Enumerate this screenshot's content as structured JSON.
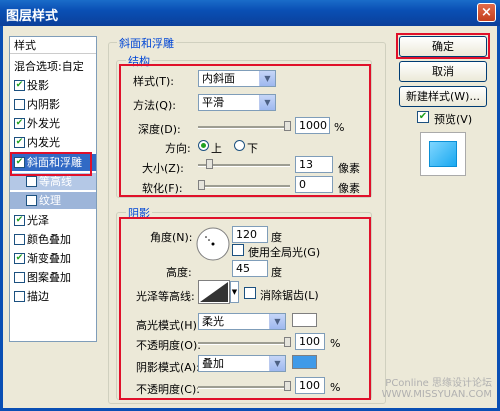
{
  "window": {
    "title": "图层样式"
  },
  "sidebar": {
    "header": "样式",
    "items": [
      {
        "label": "混合选项:自定",
        "checked": null
      },
      {
        "label": "投影",
        "checked": true
      },
      {
        "label": "内阴影",
        "checked": false
      },
      {
        "label": "外发光",
        "checked": true
      },
      {
        "label": "内发光",
        "checked": true
      },
      {
        "label": "斜面和浮雕",
        "checked": true,
        "selected": true
      },
      {
        "label": "等高线",
        "checked": false,
        "sub": true
      },
      {
        "label": "纹理",
        "checked": false,
        "sub": true
      },
      {
        "label": "光泽",
        "checked": true
      },
      {
        "label": "颜色叠加",
        "checked": false
      },
      {
        "label": "渐变叠加",
        "checked": true
      },
      {
        "label": "图案叠加",
        "checked": false
      },
      {
        "label": "描边",
        "checked": false
      }
    ]
  },
  "bevel": {
    "section_title": "斜面和浮雕",
    "structure_title": "结构",
    "style_label": "样式(T):",
    "style_value": "内斜面",
    "method_label": "方法(Q):",
    "method_value": "平滑",
    "depth_label": "深度(D):",
    "depth_value": "1000",
    "depth_unit": "%",
    "direction_label": "方向:",
    "dir_up": "上",
    "dir_down": "下",
    "size_label": "大小(Z):",
    "size_value": "13",
    "size_unit": "像素",
    "soften_label": "软化(F):",
    "soften_value": "0",
    "soften_unit": "像素"
  },
  "shading": {
    "title": "阴影",
    "angle_label": "角度(N):",
    "angle_value": "120",
    "angle_unit": "度",
    "global_light_label": "使用全局光(G)",
    "altitude_label": "高度:",
    "altitude_value": "45",
    "altitude_unit": "度",
    "gloss_label": "光泽等高线:",
    "antialias_label": "消除锯齿(L)",
    "highlight_mode_label": "高光模式(H):",
    "highlight_mode_value": "柔光",
    "highlight_color": "#ffffff",
    "highlight_opacity_label": "不透明度(O):",
    "highlight_opacity_value": "100",
    "highlight_opacity_unit": "%",
    "shadow_mode_label": "阴影模式(A):",
    "shadow_mode_value": "叠加",
    "shadow_color": "#3f9ae8",
    "shadow_opacity_label": "不透明度(C):",
    "shadow_opacity_value": "100",
    "shadow_opacity_unit": "%"
  },
  "buttons": {
    "ok": "确定",
    "cancel": "取消",
    "new_style": "新建样式(W)...",
    "preview": "预览(V)"
  },
  "watermark": "PConline 思缘设计论坛 WWW.MISSYUAN.COM"
}
